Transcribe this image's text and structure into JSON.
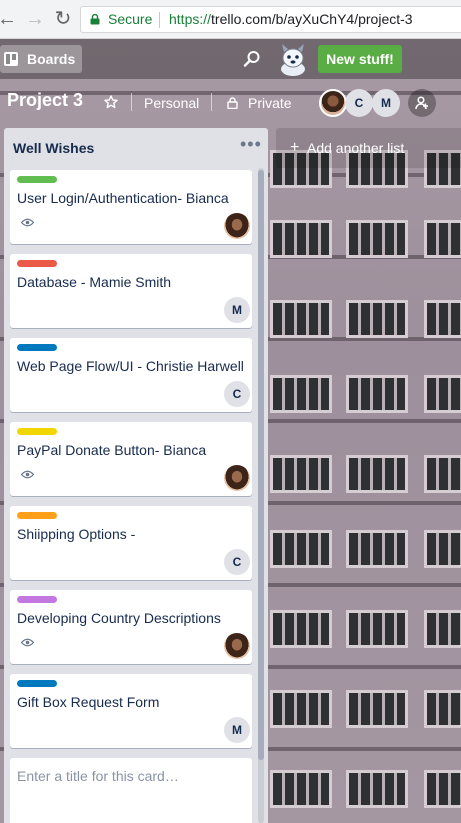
{
  "browser": {
    "secure_label": "Secure",
    "url_protocol": "https://",
    "url_rest": "trello.com/b/ayXuChY4/project-3"
  },
  "header": {
    "boards_label": "Boards",
    "new_stuff_label": "New stuff!"
  },
  "board": {
    "title": "Project 3",
    "team": "Personal",
    "privacy": "Private",
    "members": [
      {
        "initial": ""
      },
      {
        "initial": "C"
      },
      {
        "initial": "M"
      }
    ]
  },
  "list": {
    "title": "Well Wishes",
    "menu_glyph": "•••",
    "cards": [
      {
        "title": "User Login/Authentication- Bianca",
        "label_color": "#61bd4f",
        "watched": true,
        "member": ""
      },
      {
        "title": "Database - Mamie Smith",
        "label_color": "#eb5a46",
        "watched": false,
        "member": "M"
      },
      {
        "title": "Web Page Flow/UI - Christie Harwell",
        "label_color": "#0079bf",
        "watched": false,
        "member": "C"
      },
      {
        "title": "PayPal Donate Button- Bianca",
        "label_color": "#f2d600",
        "watched": true,
        "member": ""
      },
      {
        "title": "Shiipping Options -",
        "label_color": "#ff9f1a",
        "watched": false,
        "member": "C"
      },
      {
        "title": "Developing Country Descriptions",
        "label_color": "#c377e0",
        "watched": true,
        "member": ""
      },
      {
        "title": "Gift Box Request Form",
        "label_color": "#0079bf",
        "watched": false,
        "member": "M"
      }
    ],
    "new_card_placeholder": "Enter a title for this card…"
  },
  "add_list": {
    "plus": "+",
    "label": "Add another list"
  },
  "colors": {
    "new_stuff_green": "#5aac44",
    "list_bg": "#dfe1e6",
    "text_dark": "#172b4d"
  }
}
